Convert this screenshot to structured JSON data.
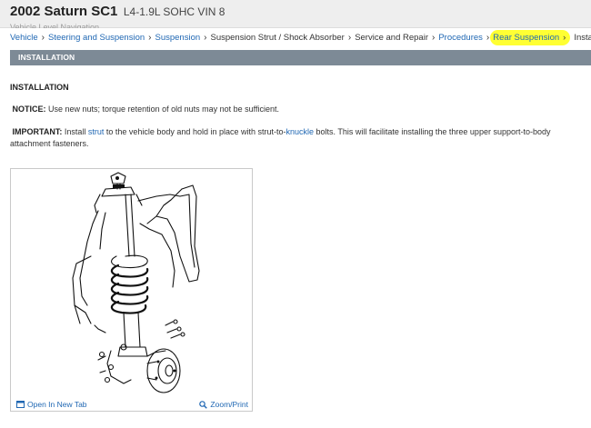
{
  "header": {
    "title": "2002 Saturn SC1",
    "engine": "L4-1.9L SOHC VIN 8",
    "subtitle_clipped": "Vehicle Level Navigation"
  },
  "breadcrumb": [
    {
      "label": "Vehicle",
      "link": true
    },
    {
      "label": "Steering and Suspension",
      "link": true
    },
    {
      "label": "Suspension",
      "link": true
    },
    {
      "label": "Suspension Strut / Shock Absorber",
      "link": false
    },
    {
      "label": "Service and Repair",
      "link": false
    },
    {
      "label": "Procedures",
      "link": true
    },
    {
      "label": "Rear Suspension",
      "link": true,
      "highlight": true
    },
    {
      "label": "Installation",
      "link": false
    }
  ],
  "section_bar": "INSTALLATION",
  "content": {
    "heading": "INSTALLATION",
    "notice_label": "NOTICE:",
    "notice_text": " Use new nuts; torque retention of old nuts may not be sufficient.",
    "important_label": "IMPORTANT:",
    "important_pre": " Install ",
    "important_link1": "strut",
    "important_mid": " to the vehicle body and hold in place with strut-to-",
    "important_link2": "knuckle",
    "important_post": " bolts. This will facilitate installing the three upper support-to-body attachment fasteners."
  },
  "figure": {
    "open_tab_label": "Open In New Tab",
    "zoom_label": "Zoom/Print",
    "icons": [
      "open-tab-icon",
      "zoom-magnifier-icon"
    ]
  },
  "colors": {
    "link": "#1f67b3",
    "section_bar": "#7d8a96",
    "highlight": "#ffff33",
    "header_bg": "#eeeeee"
  }
}
